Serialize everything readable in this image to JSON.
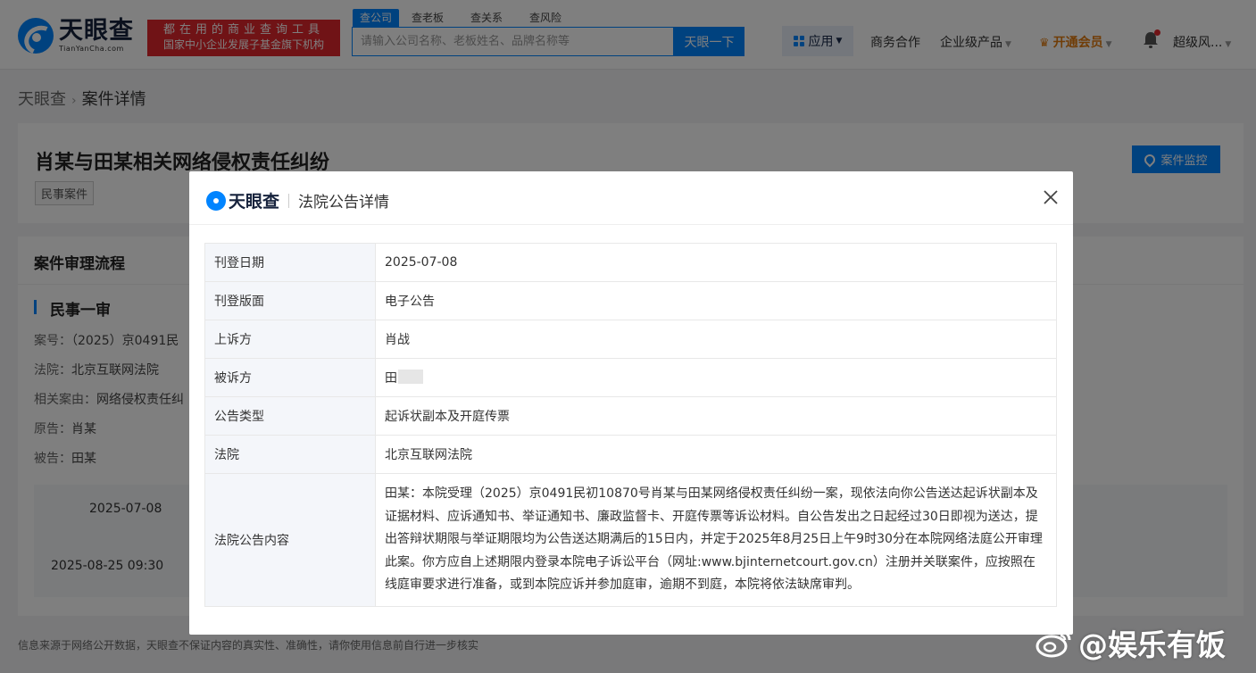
{
  "header": {
    "logo_cn": "天眼查",
    "logo_en": "TianYanCha.com",
    "slogan_line1": "都在用的商业查询工具",
    "slogan_line2": "国家中小企业发展子基金旗下机构",
    "search_tabs": [
      "查公司",
      "查老板",
      "查关系",
      "查风险"
    ],
    "search_placeholder": "请输入公司名称、老板姓名、品牌名称等",
    "search_button": "天眼一下",
    "nav": {
      "app": "应用",
      "business": "商务合作",
      "enterprise": "企业级产品",
      "vip": "开通会员",
      "user": "超级风..."
    }
  },
  "breadcrumb": {
    "home": "天眼查",
    "current": "案件详情"
  },
  "case": {
    "title": "肖某与田某相关网络侵权责任纠纷",
    "tag": "民事案件",
    "monitor_button": "案件监控"
  },
  "flow": {
    "heading": "案件审理流程",
    "stage": "民事一审",
    "lines": [
      {
        "key": "案号：",
        "value": "（2025）京0491民"
      },
      {
        "key": "法院：",
        "value": "北京互联网法院"
      },
      {
        "key": "相关案由：",
        "value": "网络侵权责任纠"
      },
      {
        "key": "原告：",
        "value": "肖某"
      },
      {
        "key": "被告：",
        "value": "田某"
      }
    ],
    "timeline": [
      "2025-07-08",
      "2025-08-25 09:30"
    ]
  },
  "footer_note": "信息来源于网络公开数据，天眼查不保证内容的真实性、准确性，请你使用信息前自行进一步核实",
  "watermark": "@娱乐有饭",
  "modal": {
    "logo": "天眼查",
    "title": "法院公告详情",
    "rows": [
      {
        "key": "刊登日期",
        "value": "2025-07-08"
      },
      {
        "key": "刊登版面",
        "value": "电子公告"
      },
      {
        "key": "上诉方",
        "value": "肖战"
      },
      {
        "key": "被诉方",
        "value": "田"
      },
      {
        "key": "公告类型",
        "value": "起诉状副本及开庭传票"
      },
      {
        "key": "法院",
        "value": "北京互联网法院"
      },
      {
        "key": "法院公告内容",
        "value": "田某：本院受理（2025）京0491民初10870号肖某与田某网络侵权责任纠纷一案，现依法向你公告送达起诉状副本及证据材料、应诉通知书、举证通知书、廉政监督卡、开庭传票等诉讼材料。自公告发出之日起经过30日即视为送达，提出答辩状期限与举证期限均为公告送达期满后的15日内，并定于2025年8月25日上午9时30分在本院网络法庭公开审理此案。你方应自上述期限内登录本院电子诉讼平台（网址:www.bjinternetcourt.gov.cn）注册并关联案件，应按照在线庭审要求进行准备，或到本院应诉并参加庭审，逾期不到庭，本院将依法缺席审判。"
      }
    ]
  },
  "colors": {
    "brand_blue": "#0084ff",
    "slogan_red": "#e0262d",
    "vip_orange": "#e07a0e"
  }
}
